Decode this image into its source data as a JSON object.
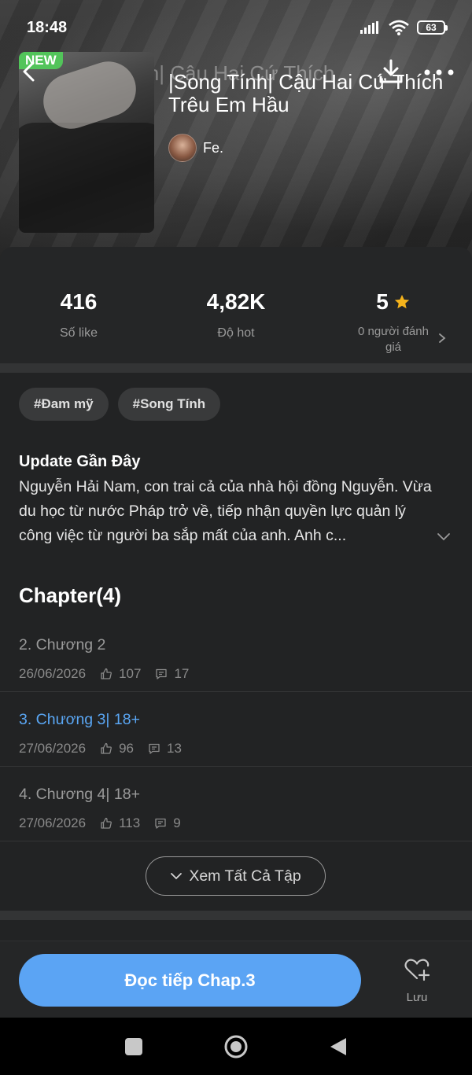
{
  "status_bar": {
    "time": "18:48",
    "battery": "63"
  },
  "header": {
    "ghost_title": "|Song Tính| Cậu Hai Cứ Thích",
    "badge": "NEW",
    "title": "|Song Tính| Cậu Hai Cứ Thích Trêu Em Hầu",
    "author": "Fe."
  },
  "stats": {
    "likes": {
      "value": "416",
      "label": "Số like"
    },
    "hot": {
      "value": "4,82K",
      "label": "Độ hot"
    },
    "rating": {
      "value": "5",
      "label": "0 người đánh giá"
    }
  },
  "tags": [
    "#Đam mỹ",
    "#Song Tính"
  ],
  "update": {
    "title": "Update Gần Đây",
    "description": "Nguyễn Hải Nam, con trai cả của nhà hội đồng Nguyễn. Vừa du học từ nước Pháp trở về, tiếp nhận quyền lực quản lý công việc từ người ba sắp mất của anh. Anh c..."
  },
  "chapters": {
    "title": "Chapter(4)",
    "items": [
      {
        "name": "2. Chương 2",
        "date": "26/06/2026",
        "likes": "107",
        "comments": "17"
      },
      {
        "name": "3. Chương 3| 18+",
        "date": "27/06/2026",
        "likes": "96",
        "comments": "13"
      },
      {
        "name": "4. Chương 4| 18+",
        "date": "27/06/2026",
        "likes": "113",
        "comments": "9"
      }
    ],
    "see_all": "Xem Tất Cả Tập"
  },
  "bottom": {
    "read_button": "Đọc tiếp Chap.3",
    "save_label": "Lưu"
  },
  "colors": {
    "accent": "#5ba4f4",
    "active_chapter": "#5aa7f5",
    "new_badge": "#52c45a",
    "star": "#f5b31c"
  },
  "icons": [
    "back-icon",
    "download-icon",
    "more-icon",
    "star-icon",
    "chevron-right-icon",
    "chevron-down-icon",
    "like-icon",
    "comment-icon",
    "heart-plus-icon"
  ]
}
